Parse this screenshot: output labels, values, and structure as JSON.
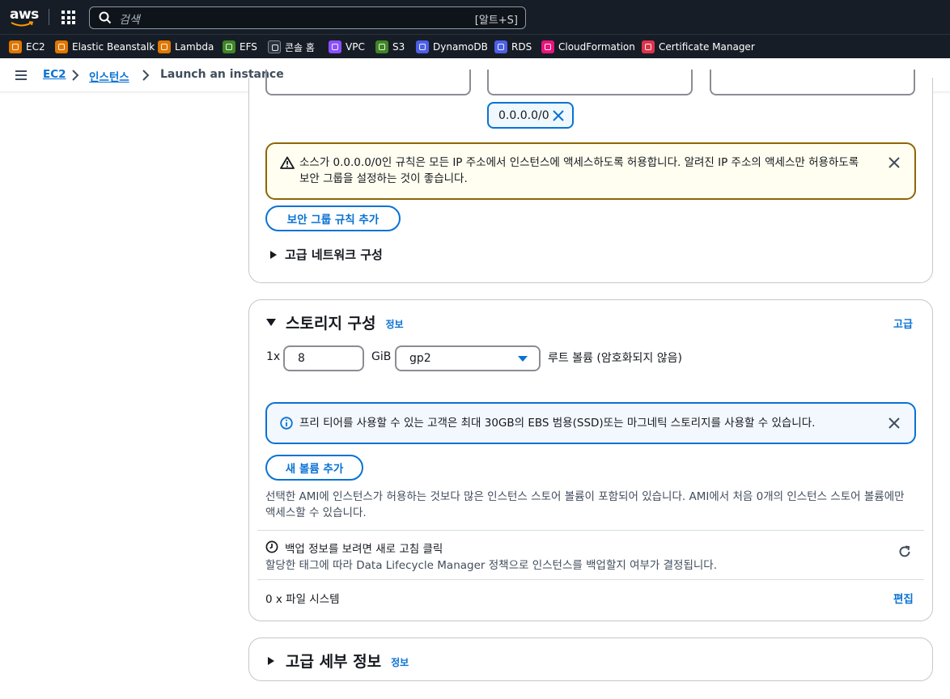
{
  "topbar": {
    "logo_text": "aws",
    "search_placeholder": "검색",
    "search_shortcut": "[알트+S]"
  },
  "favorites": [
    {
      "label": "EC2",
      "color": "#e07700"
    },
    {
      "label": "Elastic Beanstalk",
      "color": "#e07700"
    },
    {
      "label": "Lambda",
      "color": "#e07700"
    },
    {
      "label": "EFS",
      "color": "#3f8624"
    },
    {
      "label": "콘솔 홈",
      "color": "#2a323d"
    },
    {
      "label": "VPC",
      "color": "#8c4fff"
    },
    {
      "label": "S3",
      "color": "#3f8624"
    },
    {
      "label": "DynamoDB",
      "color": "#4d5fe8"
    },
    {
      "label": "RDS",
      "color": "#4d5fe8"
    },
    {
      "label": "CloudFormation",
      "color": "#e7157b"
    },
    {
      "label": "Certificate Manager",
      "color": "#dd344c"
    }
  ],
  "breadcrumb": {
    "items": [
      "EC2",
      "인스턴스"
    ],
    "current": "Launch an instance"
  },
  "network": {
    "source_token": "0.0.0.0/0",
    "warning_text": "소스가 0.0.0.0/0인 규칙은 모든 IP 주소에서 인스턴스에 액세스하도록 허용합니다. 알려진 IP 주소의 액세스만 허용하도록 보안 그룹을 설정하는 것이 좋습니다.",
    "add_rule_button": "보안 그룹 규칙 추가",
    "advanced_network": "고급 네트워크 구성"
  },
  "storage": {
    "title": "스토리지 구성",
    "info": "정보",
    "advanced_link": "고급",
    "count_prefix": "1x",
    "size_value": "8",
    "unit": "GiB",
    "volume_type": "gp2",
    "volume_desc": "루트 볼륨  (암호화되지 않음)",
    "free_tier_info": "프리 티어를 사용할 수 있는 고객은 최대 30GB의 EBS 범용(SSD)또는 마그네틱 스토리지를 사용할 수 있습니다.",
    "add_volume_button": "새 볼륨 추가",
    "ami_note": "선택한 AMI에 인스턴스가 허용하는 것보다 많은 인스턴스 스토어 볼륨이 포함되어 있습니다. AMI에서 처음 0개의 인스턴스 스토어 볼륨에만 액세스할 수 있습니다.",
    "backup_title": "백업 정보를 보려면 새로 고침 클릭",
    "backup_desc": "할당한 태그에 따라 Data Lifecycle Manager 정책으로 인스턴스를 백업할지 여부가 결정됩니다.",
    "file_systems": "0 x 파일 시스템",
    "edit_link": "편집"
  },
  "advanced_details": {
    "title": "고급 세부 정보",
    "info": "정보"
  }
}
